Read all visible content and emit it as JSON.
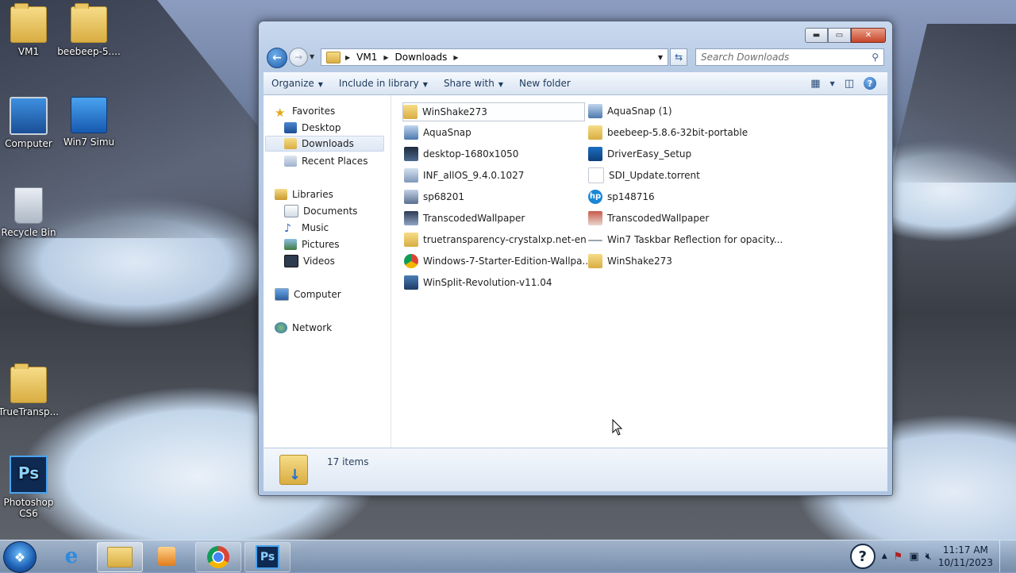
{
  "desktop": {
    "icons": [
      {
        "label": "VM1"
      },
      {
        "label": "beebeep-5...."
      },
      {
        "label": "Computer"
      },
      {
        "label": "Win7 Simu"
      },
      {
        "label": "Recycle Bin"
      },
      {
        "label": "TrueTransp..."
      },
      {
        "label": "Photoshop CS6"
      }
    ]
  },
  "window": {
    "caption_buttons": {
      "minimize": "▬",
      "maximize": "▭",
      "close": "✕"
    },
    "address": {
      "crumbs": [
        "VM1",
        "Downloads"
      ]
    },
    "search": {
      "placeholder": "Search Downloads"
    },
    "toolbar": {
      "organize": "Organize",
      "include_in_library": "Include in library",
      "share_with": "Share with",
      "new_folder": "New folder"
    },
    "nav": {
      "favorites": "Favorites",
      "desktop": "Desktop",
      "downloads": "Downloads",
      "recent_places": "Recent Places",
      "libraries": "Libraries",
      "documents": "Documents",
      "music": "Music",
      "pictures": "Pictures",
      "videos": "Videos",
      "computer": "Computer",
      "network": "Network"
    },
    "files_col1": [
      "WinShake273",
      "AquaSnap",
      "desktop-1680x1050",
      "INF_allOS_9.4.0.1027",
      "sp68201",
      "TranscodedWallpaper",
      "truetransparency-crystalxp.net-en",
      "Windows-7-Starter-Edition-Wallpa...",
      "WinSplit-Revolution-v11.04"
    ],
    "files_col2": [
      "AquaSnap (1)",
      "beebeep-5.8.6-32bit-portable",
      "DriverEasy_Setup",
      "SDI_Update.torrent",
      "sp148716",
      "TranscodedWallpaper",
      "Win7 Taskbar Reflection for opacity...",
      "WinShake273"
    ],
    "details": {
      "count": "17 items"
    }
  },
  "taskbar": {
    "clock_time": "11:17 AM",
    "clock_date": "10/11/2023"
  },
  "colors": {
    "accent": "#1f5ca8",
    "folder": "#d9ad42"
  }
}
